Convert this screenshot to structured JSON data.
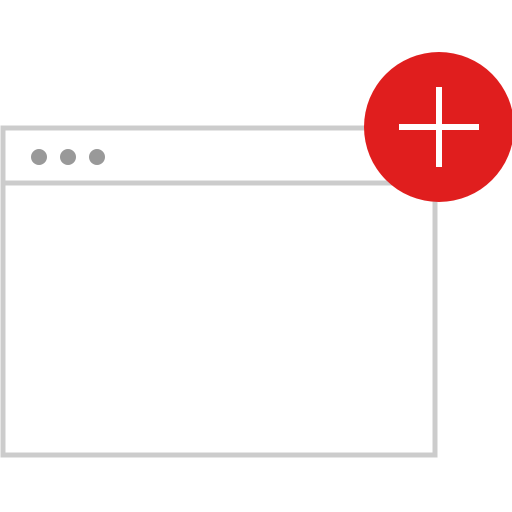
{
  "icon": {
    "name": "new-window-icon",
    "window_frame_icon": "browser-window-icon",
    "add_badge_icon": "plus-icon"
  },
  "colors": {
    "background": "#ffffff",
    "window_stroke": "#cccccc",
    "window_dots": "#999999",
    "badge_fill": "#e01e1e",
    "plus_stroke": "#ffffff"
  }
}
